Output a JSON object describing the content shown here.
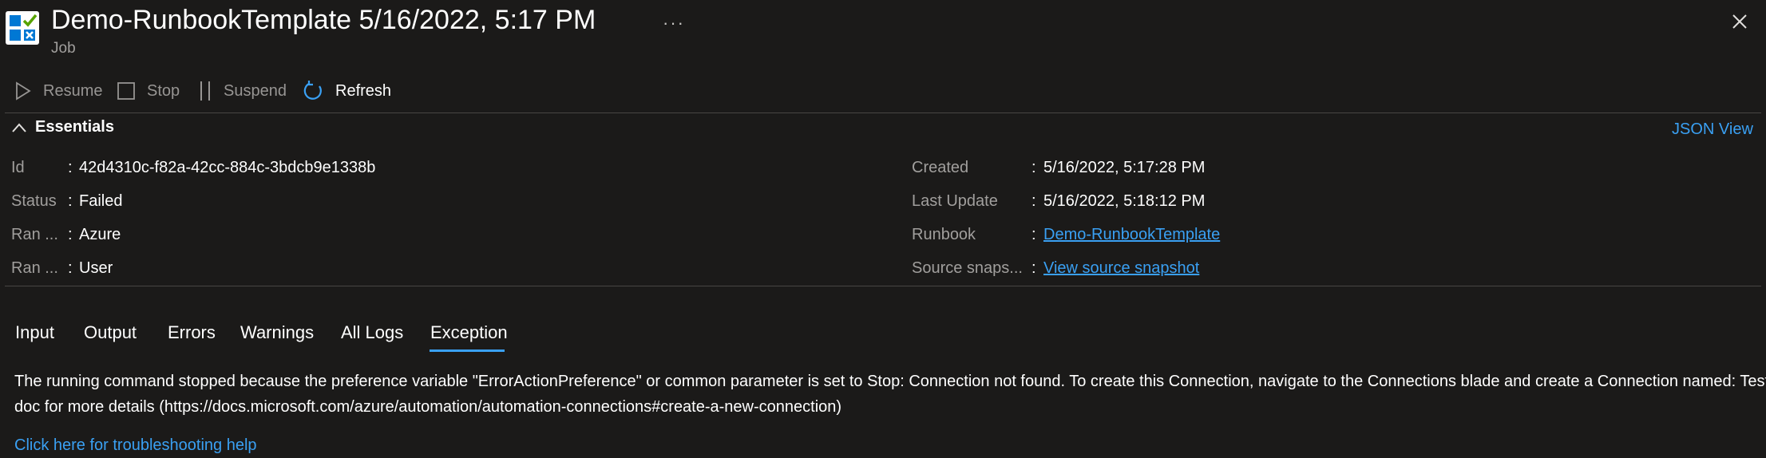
{
  "header": {
    "title": "Demo-RunbookTemplate 5/16/2022, 5:17 PM",
    "subtitle": "Job",
    "more_label": "···",
    "icon": "automation-job-icon"
  },
  "toolbar": {
    "resume_label": "Resume",
    "stop_label": "Stop",
    "suspend_label": "Suspend",
    "refresh_label": "Refresh"
  },
  "essentials": {
    "header_label": "Essentials",
    "json_view_label": "JSON View",
    "left": [
      {
        "label": "Id",
        "value": "42d4310c-f82a-42cc-884c-3bdcb9e1338b"
      },
      {
        "label": "Status",
        "value": "Failed"
      },
      {
        "label": "Ran ...",
        "value": "Azure"
      },
      {
        "label": "Ran ...",
        "value": "User"
      }
    ],
    "right": [
      {
        "label": "Created",
        "value": "5/16/2022, 5:17:28 PM"
      },
      {
        "label": "Last Update",
        "value": "5/16/2022, 5:18:12 PM"
      },
      {
        "label": "Runbook",
        "value": "Demo-RunbookTemplate"
      },
      {
        "label": "Source snaps...",
        "value": "View source snapshot"
      }
    ],
    "colon": ":"
  },
  "tabs": [
    {
      "label": "Input"
    },
    {
      "label": "Output"
    },
    {
      "label": "Errors"
    },
    {
      "label": "Warnings"
    },
    {
      "label": "All Logs"
    },
    {
      "label": "Exception",
      "selected": true
    }
  ],
  "exception": {
    "line1": "The running command stopped because the preference variable \"ErrorActionPreference\" or common parameter is set to Stop: Connection not found. To create this Connection, navigate to the Connections blade and create a Connection named: Test. Refer",
    "line2": "doc for more details (https://docs.microsoft.com/azure/automation/automation-connections#create-a-new-connection)",
    "help_link": "Click here for troubleshooting help"
  },
  "colors": {
    "background": "#1b1a19",
    "accent": "#3aa0f3",
    "muted_text": "#a19f9d"
  }
}
